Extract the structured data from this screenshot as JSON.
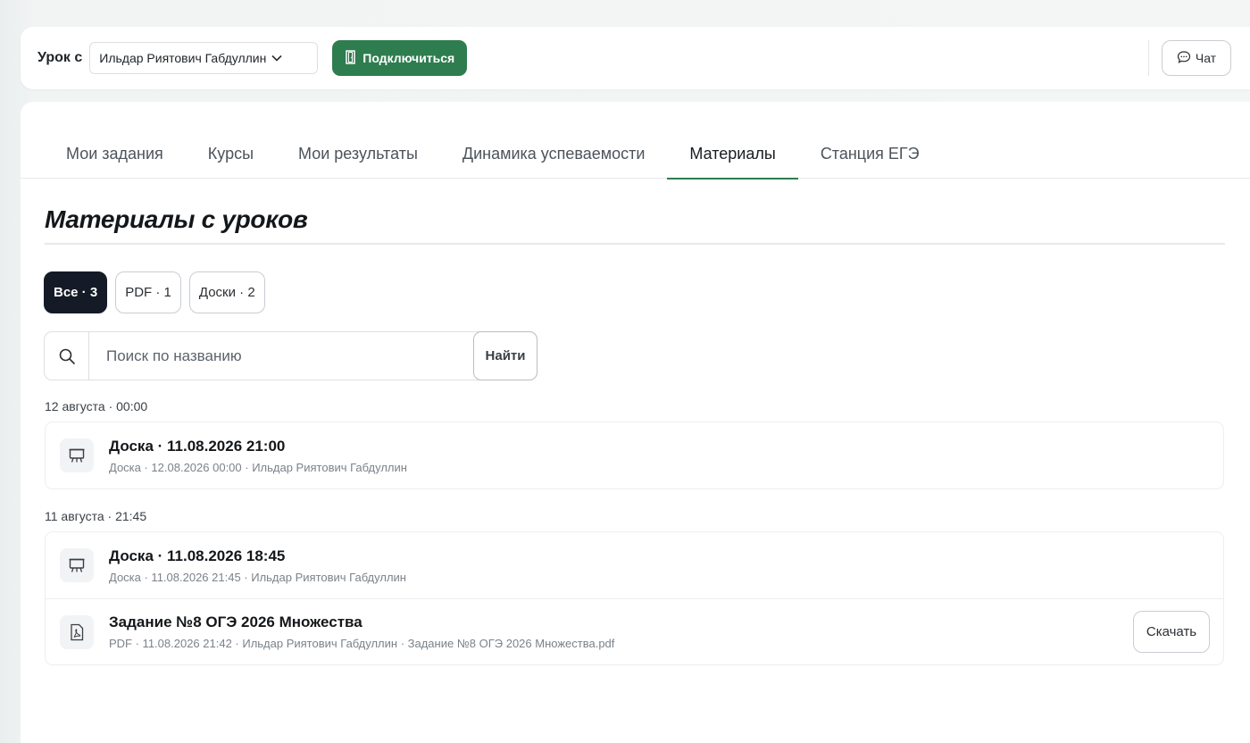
{
  "topbar": {
    "lesson_label": "Урок с",
    "teacher_selected": "Ильдар Риятович Габдуллин",
    "connect_label": "Подключиться",
    "chat_label": "Чат"
  },
  "tabs": [
    {
      "label": "Мои задания"
    },
    {
      "label": "Курсы"
    },
    {
      "label": "Мои результаты"
    },
    {
      "label": "Динамика успеваемости"
    },
    {
      "label": "Материалы",
      "active": true
    },
    {
      "label": "Станция ЕГЭ"
    }
  ],
  "page": {
    "title": "Материалы с уроков"
  },
  "filters": [
    {
      "label": "Все · 3",
      "active": true
    },
    {
      "label": "PDF · 1"
    },
    {
      "label": "Доски · 2"
    }
  ],
  "search": {
    "placeholder": "Поиск по названию",
    "button_label": "Найти"
  },
  "groups": [
    {
      "label": "12 августа · 00:00",
      "items": [
        {
          "icon": "whiteboard-icon",
          "title": "Доска · 11.08.2026 21:00",
          "meta": "Доска · 12.08.2026 00:00 · Ильдар Риятович Габдуллин"
        }
      ]
    },
    {
      "label": "11 августа · 21:45",
      "items": [
        {
          "icon": "whiteboard-icon",
          "title": "Доска · 11.08.2026 18:45",
          "meta": "Доска · 11.08.2026 21:45 · Ильдар Риятович Габдуллин"
        },
        {
          "icon": "pdf-file-icon",
          "title": "Задание №8 ОГЭ 2026 Множества",
          "meta": "PDF · 11.08.2026 21:42 · Ильдар Риятович Габдуллин · Задание №8 ОГЭ 2026 Множества.pdf",
          "action_label": "Скачать"
        }
      ]
    }
  ],
  "colors": {
    "accent": "#2e7d4f",
    "chip_active": "#141a26"
  }
}
